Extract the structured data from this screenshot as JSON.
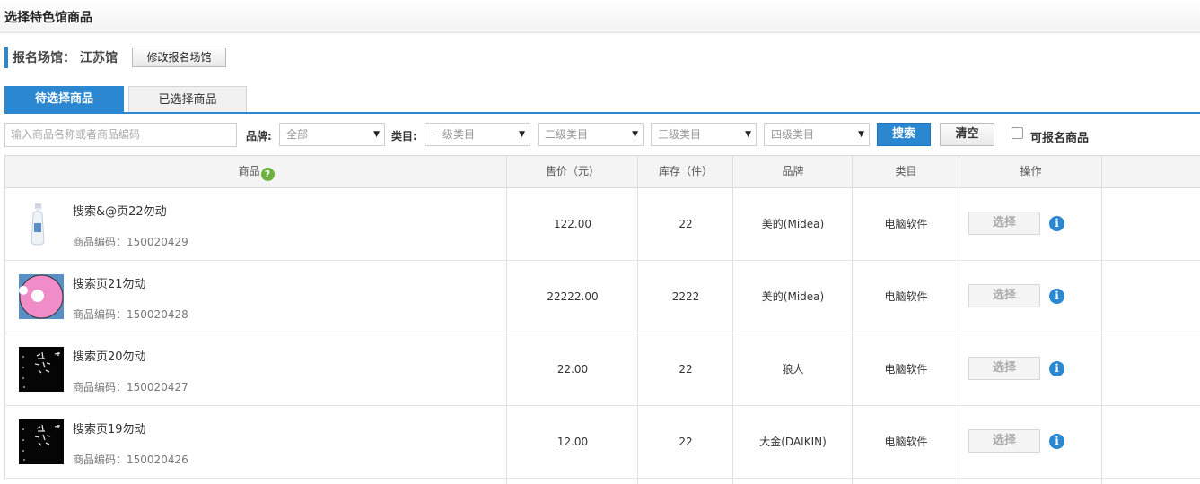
{
  "header": {
    "title": "选择特色馆商品"
  },
  "venue": {
    "label": "报名场馆：",
    "value": "江苏馆",
    "modify_button": "修改报名场馆"
  },
  "tabs": [
    {
      "label": "待选择商品",
      "active": true
    },
    {
      "label": "已选择商品",
      "active": false
    }
  ],
  "filters": {
    "search_placeholder": "输入商品名称或者商品编码",
    "brand_label": "品牌:",
    "brand_value": "全部",
    "category_label": "类目:",
    "category_levels": [
      "一级类目",
      "二级类目",
      "三级类目",
      "四级类目"
    ],
    "search_button": "搜索",
    "clear_button": "清空",
    "eligible_checkbox_label": "可报名商品",
    "eligible_checked": false
  },
  "table": {
    "columns": [
      "商品",
      "售价（元）",
      "库存（件）",
      "品牌",
      "类目",
      "操作"
    ],
    "help_icon": "question-icon",
    "rows": [
      {
        "name": "搜索&@页22勿动",
        "code_label": "商品编码：",
        "code": "150020429",
        "price": "122.00",
        "stock": "22",
        "brand": "美的(Midea)",
        "category": "电脑软件",
        "action": "选择",
        "thumb": "bottle"
      },
      {
        "name": "搜索页21勿动",
        "code_label": "商品编码：",
        "code": "150020428",
        "price": "22222.00",
        "stock": "2222",
        "brand": "美的(Midea)",
        "category": "电脑软件",
        "action": "选择",
        "thumb": "pink-circle"
      },
      {
        "name": "搜索页20勿动",
        "code_label": "商品编码：",
        "code": "150020427",
        "price": "22.00",
        "stock": "22",
        "brand": "狼人",
        "category": "电脑软件",
        "action": "选择",
        "thumb": "black-text"
      },
      {
        "name": "搜索页19勿动",
        "code_label": "商品编码：",
        "code": "150020426",
        "price": "12.00",
        "stock": "22",
        "brand": "大金(DAIKIN)",
        "category": "电脑软件",
        "action": "选择",
        "thumb": "black-text"
      }
    ]
  },
  "colors": {
    "accent": "#2a87d0",
    "help_icon": "#6cb33e"
  }
}
